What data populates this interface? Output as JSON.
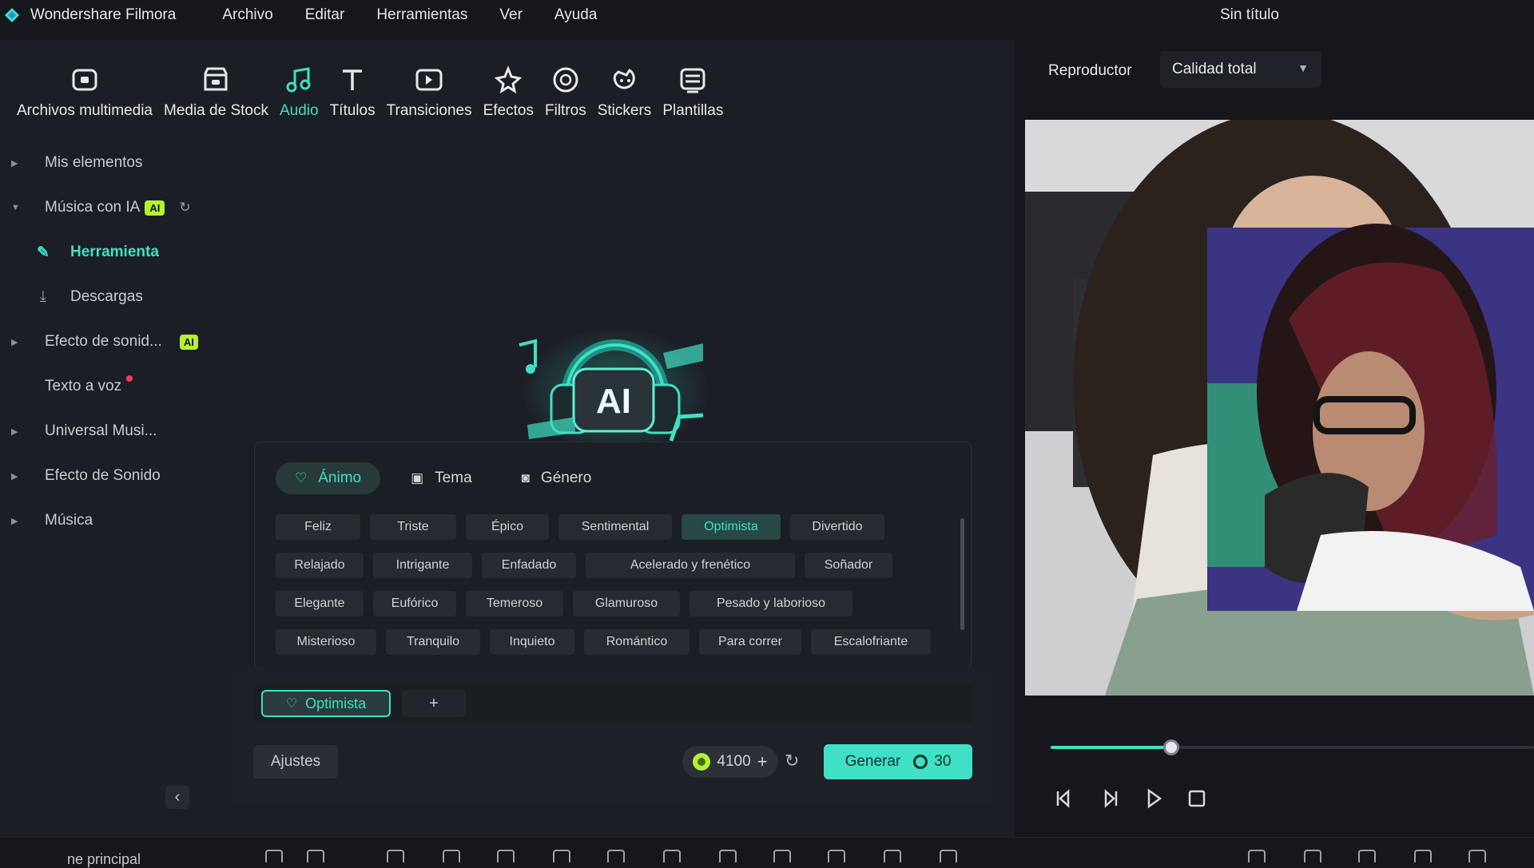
{
  "app": {
    "name": "Wondershare Filmora",
    "document_title": "Sin título"
  },
  "menu": [
    "Archivo",
    "Editar",
    "Herramientas",
    "Ver",
    "Ayuda"
  ],
  "toolbar": [
    {
      "label": "Archivos multimedia",
      "icon": "media-icon"
    },
    {
      "label": "Media de Stock",
      "icon": "stock-media-icon"
    },
    {
      "label": "Audio",
      "icon": "music-note-icon",
      "active": true
    },
    {
      "label": "Títulos",
      "icon": "text-icon"
    },
    {
      "label": "Transiciones",
      "icon": "transition-icon"
    },
    {
      "label": "Efectos",
      "icon": "effects-icon"
    },
    {
      "label": "Filtros",
      "icon": "filter-icon"
    },
    {
      "label": "Stickers",
      "icon": "sticker-icon"
    },
    {
      "label": "Plantillas",
      "icon": "template-icon"
    }
  ],
  "sidebar": {
    "items": [
      {
        "label": "Mis elementos"
      },
      {
        "label": "Música con IA",
        "badge": "AI"
      },
      {
        "label": "Herramienta",
        "active": true
      },
      {
        "label": "Descargas"
      },
      {
        "label": "Efecto de sonid...",
        "badge": "AI"
      },
      {
        "label": "Texto a voz"
      },
      {
        "label": "Universal Musi..."
      },
      {
        "label": "Efecto de Sonido"
      },
      {
        "label": "Música"
      }
    ]
  },
  "hero": {
    "text": "AI"
  },
  "mood_tabs": [
    {
      "label": "Ánimo",
      "active": true
    },
    {
      "label": "Tema"
    },
    {
      "label": "Género"
    }
  ],
  "moods": [
    [
      "Feliz",
      "Triste",
      "Épico",
      "Sentimental",
      "Optimista",
      "Divertido"
    ],
    [
      "Relajado",
      "Intrigante",
      "Enfadado",
      "Acelerado y frenético",
      "Soñador"
    ],
    [
      "Elegante",
      "Eufórico",
      "Temeroso",
      "Glamuroso",
      "Pesado y laborioso"
    ],
    [
      "Misterioso",
      "Tranquilo",
      "Inquieto",
      "Romántico",
      "Para correr",
      "Escalofriante"
    ]
  ],
  "selected_mood": "Optimista",
  "add_label": "+",
  "settings_label": "Ajustes",
  "credits": "4100",
  "generate": {
    "label": "Generar",
    "cost": "30"
  },
  "player": {
    "title": "Reproductor",
    "quality": "Calidad total",
    "progress": 0.25
  },
  "timeline": {
    "track_label": "ne principal"
  },
  "colors": {
    "accent": "#3fe0c5",
    "ai_badge": "#b6f034",
    "background": "#15171c",
    "panel": "#1b1e24"
  }
}
